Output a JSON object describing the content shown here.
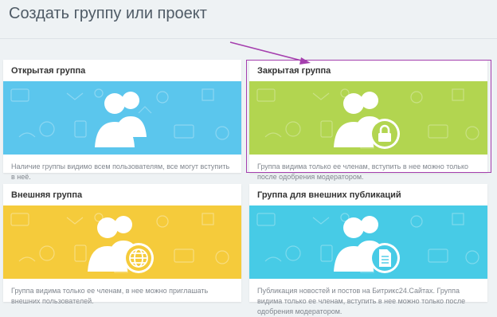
{
  "page": {
    "title": "Создать группу или проект"
  },
  "colors": {
    "open": "#5bc6ed",
    "closed": "#b2d550",
    "external": "#f5cb3b",
    "publications": "#47cbe6",
    "highlight": "#a53fae",
    "arrow": "#a53fae"
  },
  "cards": [
    {
      "title": "Открытая группа",
      "description": "Наличие группы видимо всем пользователям, все могут вступить в неё.",
      "badge_icon": "none"
    },
    {
      "title": "Закрытая группа",
      "description": "Группа видима только ее членам, вступить в нее можно только после одобрения модератором.",
      "badge_icon": "lock-icon"
    },
    {
      "title": "Внешняя группа",
      "description": "Группа видима только ее членам, в нее можно приглашать внешних пользователей.",
      "badge_icon": "globe-icon"
    },
    {
      "title": "Группа для внешних публикаций",
      "description": "Публикация новостей и постов на Битрикс24.Сайтах. Группа видима только ее членам, вступить в нее можно только после одобрения модератором.",
      "badge_icon": "document-icon"
    }
  ]
}
